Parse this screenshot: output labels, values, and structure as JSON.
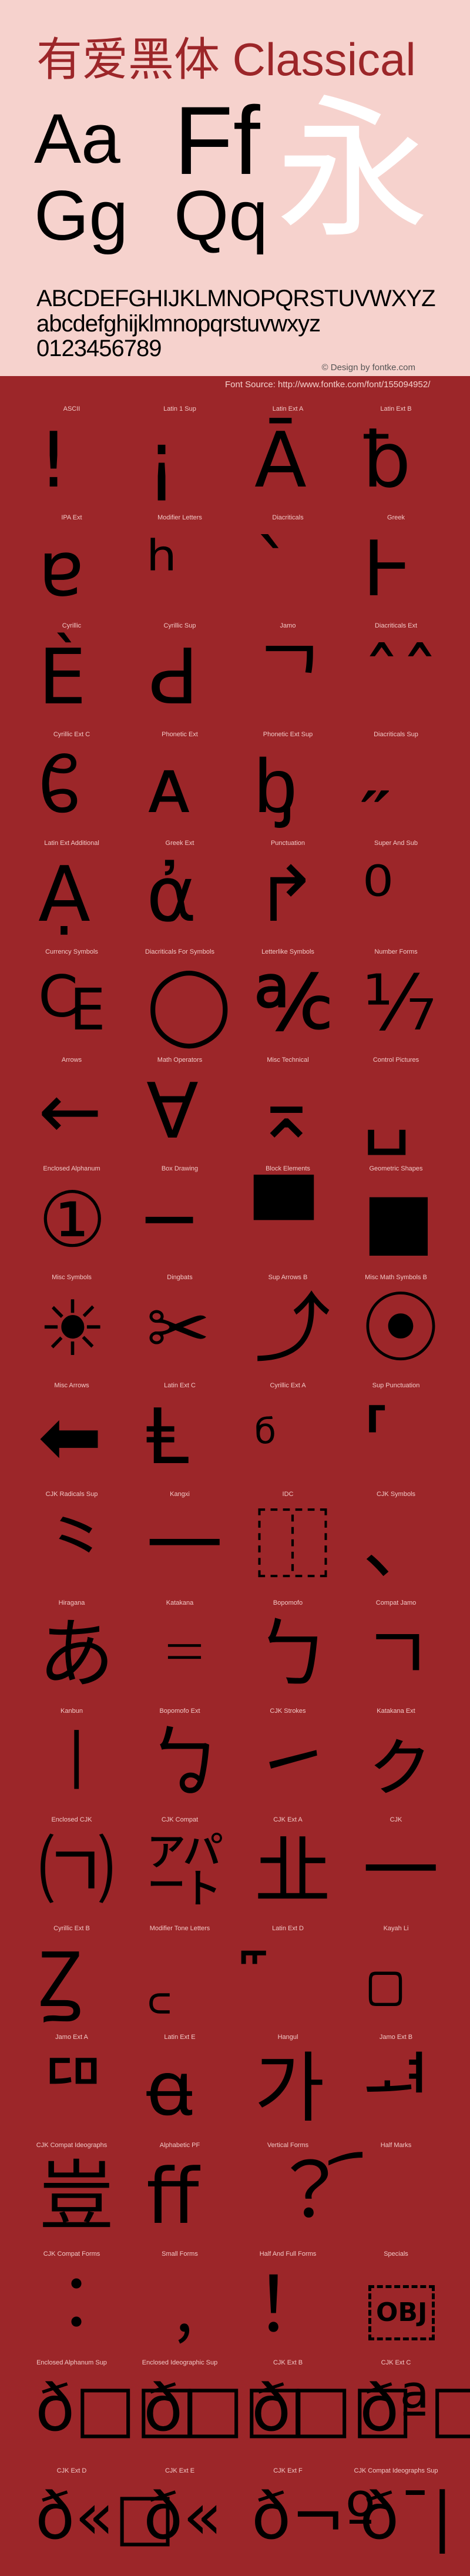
{
  "header": {
    "title": "有爱黑体 Classical",
    "samples": [
      "Aa",
      "Ff",
      "Gg",
      "Qq",
      "永"
    ],
    "uppercase": "ABCDEFGHIJKLMNOPQRSTUVWXYZ",
    "lowercase": "abcdefghijklmnopqrstuvwxyz",
    "digits": "0123456789",
    "credit": "© Design by fontke.com",
    "source": "Font Source: http://www.fontke.com/font/155094952/"
  },
  "colors": {
    "header_bg": "#f6d2cd",
    "body_bg": "#9c2629",
    "title": "#9c2629",
    "glyph": "#000000",
    "accent_glyph": "#ffffff"
  },
  "blocks": [
    {
      "label": "ASCII",
      "glyph": "!"
    },
    {
      "label": "Latin 1 Sup",
      "glyph": "¡"
    },
    {
      "label": "Latin Ext A",
      "glyph": "Ā"
    },
    {
      "label": "Latin Ext B",
      "glyph": "ƀ"
    },
    {
      "label": "IPA Ext",
      "glyph": "ɐ"
    },
    {
      "label": "Modifier Letters",
      "glyph": "ʰ"
    },
    {
      "label": "Diacriticals",
      "glyph": "`"
    },
    {
      "label": "Greek",
      "glyph": "Ͱ"
    },
    {
      "label": "Cyrillic",
      "glyph": "Ѐ"
    },
    {
      "label": "Cyrillic Sup",
      "glyph": "Ԁ"
    },
    {
      "label": "Jamo",
      "glyph": "ᄀ"
    },
    {
      "label": "Diacriticals Ext",
      "glyph": "ˆˆ"
    },
    {
      "label": "Cyrillic Ext C",
      "glyph": "ᲀ"
    },
    {
      "label": "Phonetic Ext",
      "glyph": "ᴀ"
    },
    {
      "label": "Phonetic Ext Sup",
      "glyph": "ᶀ"
    },
    {
      "label": "Diacriticals Sup",
      "glyph": "˶"
    },
    {
      "label": "Latin Ext Additional",
      "glyph": "Ạ"
    },
    {
      "label": "Greek Ext",
      "glyph": "ἀ"
    },
    {
      "label": "Punctuation",
      "glyph": "↱"
    },
    {
      "label": "Super And Sub",
      "glyph": "⁰"
    },
    {
      "label": "Currency Symbols",
      "glyph": "₠"
    },
    {
      "label": "Diacriticals For Symbols",
      "glyph": "◯"
    },
    {
      "label": "Letterlike Symbols",
      "glyph": "℀"
    },
    {
      "label": "Number Forms",
      "glyph": "⅐"
    },
    {
      "label": "Arrows",
      "glyph": "←"
    },
    {
      "label": "Math Operators",
      "glyph": "∀"
    },
    {
      "label": "Misc Technical",
      "glyph": "⌅"
    },
    {
      "label": "Control Pictures",
      "glyph": "␣"
    },
    {
      "label": "Enclosed Alphanum",
      "glyph": "①"
    },
    {
      "label": "Box Drawing",
      "glyph": "─"
    },
    {
      "label": "Block Elements",
      "glyph": "▀"
    },
    {
      "label": "Geometric Shapes",
      "glyph": "■"
    },
    {
      "label": "Misc Symbols",
      "glyph": "☀"
    },
    {
      "label": "Dingbats",
      "glyph": "✂"
    },
    {
      "label": "Sup Arrows B",
      "glyph": "⤴"
    },
    {
      "label": "Misc Math Symbols B",
      "glyph": "⦿"
    },
    {
      "label": "Misc Arrows",
      "glyph": "⬅"
    },
    {
      "label": "Latin Ext C",
      "glyph": "Ⱡ"
    },
    {
      "label": "Cyrillic Ext A",
      "glyph": "б",
      "style": "small"
    },
    {
      "label": "Sup Punctuation",
      "glyph": "⸢"
    },
    {
      "label": "CJK Radicals Sup",
      "glyph": "⺀"
    },
    {
      "label": "Kangxi",
      "glyph": "⼀"
    },
    {
      "label": "IDC",
      "glyph": "⿰"
    },
    {
      "label": "CJK Symbols",
      "glyph": "、"
    },
    {
      "label": "Hiragana",
      "glyph": "あ"
    },
    {
      "label": "Katakana",
      "glyph": "゠"
    },
    {
      "label": "Bopomofo",
      "glyph": "ㄅ"
    },
    {
      "label": "Compat Jamo",
      "glyph": "ㄱ"
    },
    {
      "label": "Kanbun",
      "glyph": "㆐"
    },
    {
      "label": "Bopomofo Ext",
      "glyph": "ㆠ"
    },
    {
      "label": "CJK Strokes",
      "glyph": "㇀"
    },
    {
      "label": "Katakana Ext",
      "glyph": "ㇰ"
    },
    {
      "label": "Enclosed CJK",
      "glyph": "㈀"
    },
    {
      "label": "CJK Compat",
      "glyph": "㌀"
    },
    {
      "label": "CJK Ext A",
      "glyph": "㐀"
    },
    {
      "label": "CJK",
      "glyph": "一"
    },
    {
      "label": "Cyrillic Ext B",
      "glyph": "Ꙁ"
    },
    {
      "label": "Modifier Tone Letters",
      "glyph": "꜀"
    },
    {
      "label": "Latin Ext D",
      "glyph": "꜠"
    },
    {
      "label": "Kayah Li",
      "glyph": "꤀"
    },
    {
      "label": "Jamo Ext A",
      "glyph": "ꥠ"
    },
    {
      "label": "Latin Ext E",
      "glyph": "ꬰ"
    },
    {
      "label": "Hangul",
      "glyph": "가"
    },
    {
      "label": "Jamo Ext B",
      "glyph": "ힰ"
    },
    {
      "label": "CJK Compat Ideographs",
      "glyph": "豈"
    },
    {
      "label": "Alphabetic PF",
      "glyph": "ﬀ"
    },
    {
      "label": "Vertical Forms",
      "glyph": "︖"
    },
    {
      "label": "Half Marks",
      "glyph": "︠"
    },
    {
      "label": "CJK Compat Forms",
      "glyph": "︰"
    },
    {
      "label": "Small Forms",
      "glyph": "﹐"
    },
    {
      "label": "Half And Full Forms",
      "glyph": "！"
    },
    {
      "label": "Specials",
      "glyph": "OBJ",
      "style": "boxed"
    },
    {
      "label": "Enclosed Alphanum Sup",
      "glyph": "ð□□",
      "style": "wide"
    },
    {
      "label": "Enclosed Ideographic Sup",
      "glyph": "ð□□",
      "style": "wide"
    },
    {
      "label": "CJK Ext B",
      "glyph": "ð□□",
      "style": "wide"
    },
    {
      "label": "CJK Ext C",
      "glyph": "ðª□",
      "style": "wide"
    },
    {
      "label": "CJK Ext D",
      "glyph": "ð«□",
      "style": "wide"
    },
    {
      "label": "CJK Ext E",
      "glyph": "ð«",
      "style": "wide"
    },
    {
      "label": "CJK Ext F",
      "glyph": "ð¬º",
      "style": "wide"
    },
    {
      "label": "CJK Compat Ideographs Sup",
      "glyph": "ð¯|",
      "style": "wide"
    }
  ]
}
